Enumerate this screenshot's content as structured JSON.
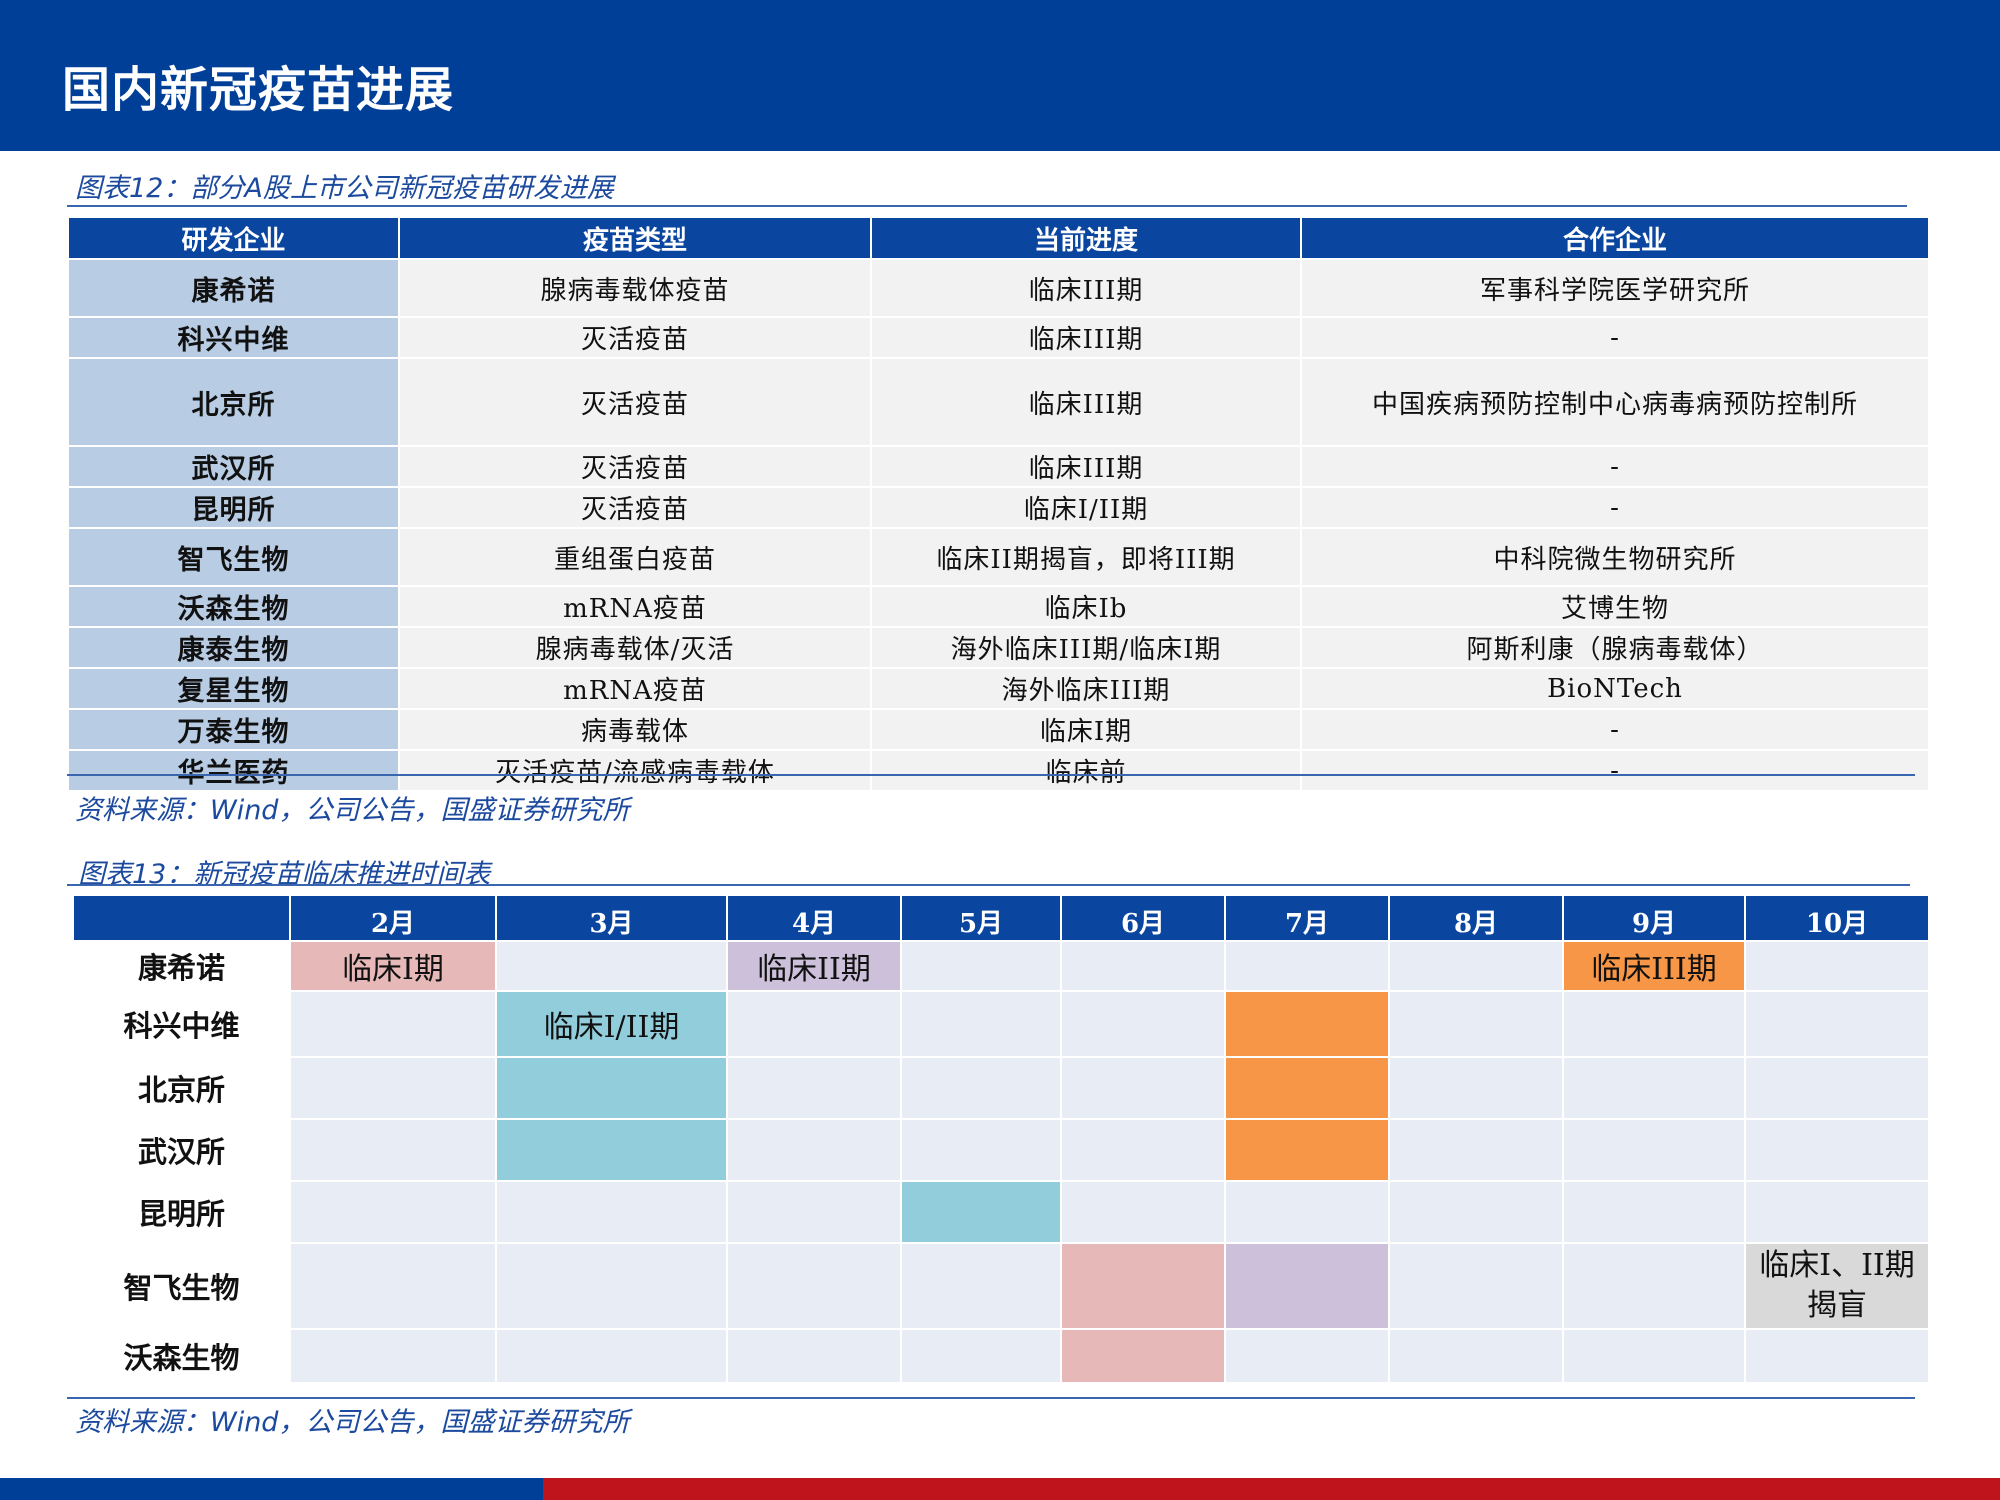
{
  "header": {
    "title": "国内新冠疫苗进展"
  },
  "table12": {
    "caption": "图表12：部分A股上市公司新冠疫苗研发进展",
    "columns": [
      "研发企业",
      "疫苗类型",
      "当前进度",
      "合作企业"
    ],
    "rows": [
      [
        "康希诺",
        "腺病毒载体疫苗",
        "临床III期",
        "军事科学院医学研究所"
      ],
      [
        "科兴中维",
        "灭活疫苗",
        "临床III期",
        "-"
      ],
      [
        "北京所",
        "灭活疫苗",
        "临床III期",
        "中国疾病预防控制中心病毒病预防控制所"
      ],
      [
        "武汉所",
        "灭活疫苗",
        "临床III期",
        "-"
      ],
      [
        "昆明所",
        "灭活疫苗",
        "临床I/II期",
        "-"
      ],
      [
        "智飞生物",
        "重组蛋白疫苗",
        "临床II期揭盲，即将III期",
        "中科院微生物研究所"
      ],
      [
        "沃森生物",
        "mRNA疫苗",
        "临床Ib",
        "艾博生物"
      ],
      [
        "康泰生物",
        "腺病毒载体/灭活",
        "海外临床III期/临床I期",
        "阿斯利康（腺病毒载体）"
      ],
      [
        "复星生物",
        "mRNA疫苗",
        "海外临床III期",
        "BioNTech"
      ],
      [
        "万泰生物",
        "病毒载体",
        "临床I期",
        "-"
      ],
      [
        "华兰医药",
        "灭活疫苗/流感病毒载体",
        "临床前",
        "-"
      ]
    ],
    "source": "资料来源：Wind，公司公告，国盛证券研究所"
  },
  "table13": {
    "caption": "图表13：新冠疫苗临床推进时间表",
    "months": [
      "2月",
      "3月",
      "4月",
      "5月",
      "6月",
      "7月",
      "8月",
      "9月",
      "10月"
    ],
    "companies": [
      "康希诺",
      "科兴中维",
      "北京所",
      "武汉所",
      "昆明所",
      "智飞生物",
      "沃森生物"
    ],
    "labels": {
      "kxn_feb": "临床I期",
      "kxn_apr": "临床II期",
      "kxn_sep": "临床III期",
      "kxzw_mar": "临床I/II期",
      "zf_oct": "临床I、II期揭盲"
    },
    "colors": {
      "pink": "#e6b8b8",
      "purple": "#ccc0da",
      "orange": "#f79646",
      "blue": "#92cddc",
      "grey": "#d9d9d9"
    },
    "source": "资料来源：Wind，公司公告，国盛证券研究所"
  },
  "theme": {
    "header_blue": "#003f98",
    "table_header_blue": "#0a46a0",
    "footer_red": "#c0141c"
  }
}
